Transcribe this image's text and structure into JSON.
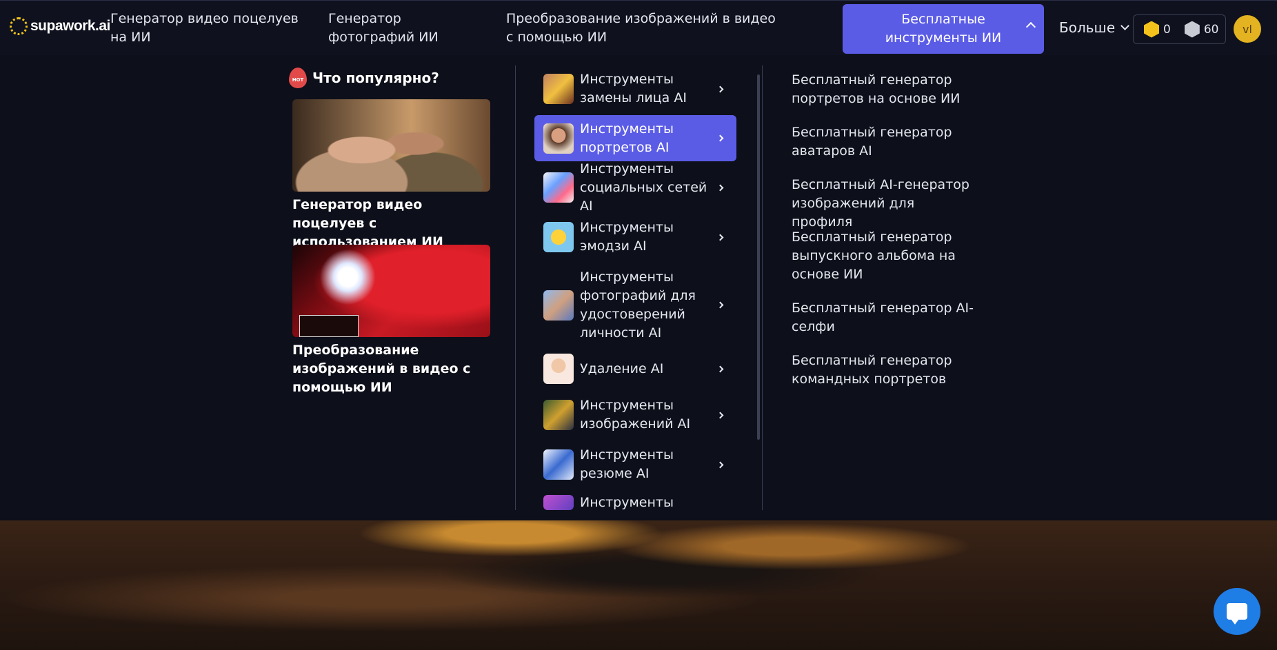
{
  "header": {
    "logo_text": "supawork.ai",
    "nav": [
      "Генератор видео поцелуев на ИИ",
      "Генератор фотографий ИИ",
      "Преобразование изображений в видео с помощью ИИ"
    ],
    "active_nav": "Бесплатные инструменты ИИ",
    "more_label": "Больше",
    "credits_gold": "0",
    "credits_silver": "60",
    "avatar_initials": "vl"
  },
  "popular": {
    "title": "Что популярно?",
    "hot_badge": "HOT",
    "cards": [
      {
        "title": "Генератор видео поцелуев с использованием ИИ"
      },
      {
        "title": "Преобразование изображений в видео с помощью ИИ"
      }
    ]
  },
  "categories": [
    {
      "label": "Инструменты замены лица AI",
      "icon": "face-swap-icon"
    },
    {
      "label": "Инструменты портретов AI",
      "icon": "portrait-icon"
    },
    {
      "label": "Инструменты социальных сетей AI",
      "icon": "social-media-icon"
    },
    {
      "label": "Инструменты эмодзи AI",
      "icon": "emoji-icon"
    },
    {
      "label": "Инструменты фотографий для удостоверений личности AI",
      "icon": "id-photo-icon"
    },
    {
      "label": "Удаление AI",
      "icon": "removal-icon"
    },
    {
      "label": "Инструменты изображений AI",
      "icon": "image-tools-icon"
    },
    {
      "label": "Инструменты резюме AI",
      "icon": "resume-icon"
    },
    {
      "label": "Инструменты видео",
      "icon": "video-tools-icon"
    }
  ],
  "subitems": [
    "Бесплатный генератор портретов на основе ИИ",
    "Бесплатный генератор аватаров AI",
    "Бесплатный AI-генератор изображений для профиля",
    "Бесплатный генератор выпускного альбома на основе ИИ",
    "Бесплатный генератор AI-селфи",
    "Бесплатный генератор командных портретов"
  ],
  "colors": {
    "accent": "#5b5ce6",
    "background": "#0d0f1a",
    "chat_button": "#1f7de6",
    "gold": "#f4c21b"
  }
}
